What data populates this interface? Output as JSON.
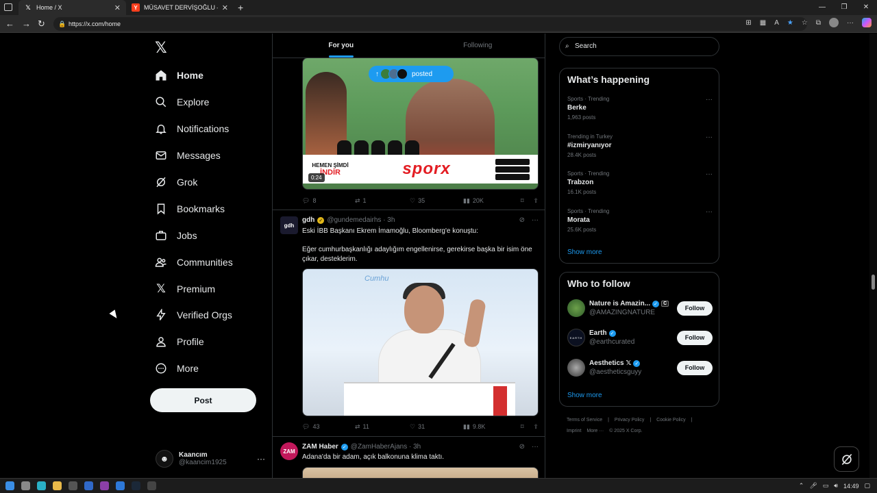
{
  "browser": {
    "tabs": [
      {
        "title": "Home / X",
        "active": true
      },
      {
        "title": "MÜSAVET DERVİŞOĞLU — Yande",
        "active": false
      }
    ],
    "url": "https://x.com/home",
    "clock": "14:49"
  },
  "nav": {
    "items": [
      {
        "label": "Home",
        "icon": "home-icon"
      },
      {
        "label": "Explore",
        "icon": "search-icon"
      },
      {
        "label": "Notifications",
        "icon": "bell-icon"
      },
      {
        "label": "Messages",
        "icon": "envelope-icon"
      },
      {
        "label": "Grok",
        "icon": "grok-icon"
      },
      {
        "label": "Bookmarks",
        "icon": "bookmark-icon"
      },
      {
        "label": "Jobs",
        "icon": "briefcase-icon"
      },
      {
        "label": "Communities",
        "icon": "people-icon"
      },
      {
        "label": "Premium",
        "icon": "x-icon"
      },
      {
        "label": "Verified Orgs",
        "icon": "lightning-icon"
      },
      {
        "label": "Profile",
        "icon": "person-icon"
      },
      {
        "label": "More",
        "icon": "more-circle-icon"
      }
    ],
    "post_label": "Post",
    "account": {
      "name": "Kaancım",
      "handle": "@kaancim1925"
    }
  },
  "feed": {
    "tabs": [
      "For you",
      "Following"
    ],
    "posted_pill": "posted",
    "tweet1": {
      "duration": "0:24",
      "ad_line1": "HEMEN ŞİMDİ",
      "ad_line2": "İNDİR",
      "ad_brand": "sporx",
      "replies": "8",
      "reposts": "1",
      "likes": "35",
      "views": "20K"
    },
    "tweet2": {
      "avatar": "gdh",
      "name": "gdh",
      "handle": "@gundemedairhs · 3h",
      "text1": "Eski İBB Başkanı Ekrem İmamoğlu, Bloomberg'e konuştu:",
      "text2": "Eğer cumhurbaşkanlığı adaylığım engellenirse, gerekirse başka bir isim öne çıkar, desteklerim.",
      "banner": "Cumhu",
      "replies": "43",
      "reposts": "11",
      "likes": "31",
      "views": "9.8K"
    },
    "tweet3": {
      "avatar": "ZAM",
      "name": "ZAM Haber",
      "handle": "@ZamHaberAjans · 3h",
      "text": "Adana'da bir adam, açık balkonuna klima taktı."
    }
  },
  "sidebar": {
    "search_placeholder": "Search",
    "trends_title": "What’s happening",
    "trends": [
      {
        "category": "Sports · Trending",
        "name": "Berke",
        "count": "1,963 posts"
      },
      {
        "category": "Trending in Turkey",
        "name": "#izmiryanıyor",
        "count": "28.4K posts"
      },
      {
        "category": "Sports · Trending",
        "name": "Trabzon",
        "count": "16.1K posts"
      },
      {
        "category": "Sports · Trending",
        "name": "Morata",
        "count": "25.6K posts"
      }
    ],
    "show_more": "Show more",
    "wtf_title": "Who to follow",
    "follow_label": "Follow",
    "who_to_follow": [
      {
        "name": "Nature is Amazin...",
        "handle": "@AMAZINGNATURE",
        "badge": "C"
      },
      {
        "name": "Earth",
        "handle": "@earthcurated",
        "avatar_text": "EARTH"
      },
      {
        "name": "Aesthetics 𝕏",
        "handle": "@aestheticsguyy"
      }
    ],
    "footer": [
      "Terms of Service",
      "|",
      "Privacy Policy",
      "|",
      "Cookie Policy",
      "|",
      "Imprint",
      "More ···",
      "© 2025 X Corp."
    ]
  }
}
